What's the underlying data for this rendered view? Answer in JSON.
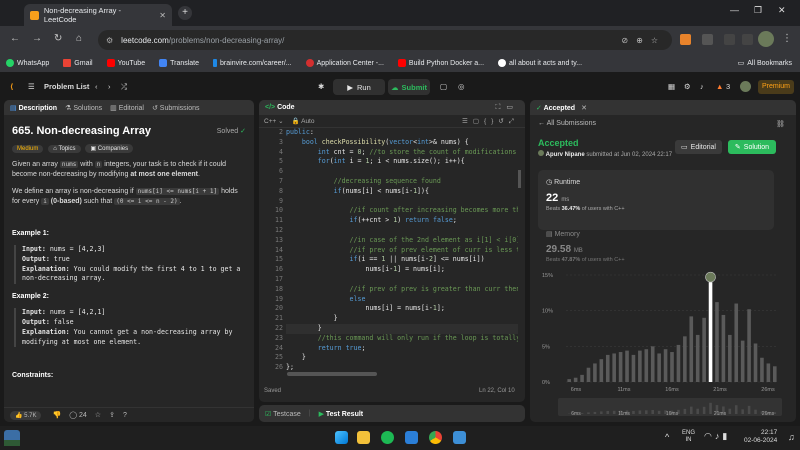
{
  "browser": {
    "tab_title": "Non-decreasing Array - LeetCode",
    "url_host": "leetcode.com",
    "url_path": "/problems/non-decreasing-array/",
    "bookmarks": [
      "WhatsApp",
      "Gmail",
      "YouTube",
      "Translate",
      "brainvire.com/career/...",
      "Application Center -...",
      "Build Python Docker a...",
      "all about it acts and ty..."
    ],
    "all_bookmarks": "All Bookmarks"
  },
  "nav": {
    "problem_list": "Problem List",
    "run": "Run",
    "submit": "Submit",
    "streak": "3",
    "premium": "Premium"
  },
  "description": {
    "tabs": [
      "Description",
      "Solutions",
      "Editorial",
      "Submissions"
    ],
    "title": "665. Non-decreasing Array",
    "solved": "Solved",
    "difficulty": "Medium",
    "topics": "Topics",
    "companies": "Companies",
    "p1a": "Given an array",
    "p1code": "nums",
    "p1b": "with",
    "p1n": "n",
    "p1c": "integers, your task is to check if it could become non-decreasing by modifying",
    "p1bold": "at most one element",
    "p2a": "We define an array is non-decreasing if",
    "p2code": "nums[i] <= nums[i + 1]",
    "p2b": "holds for every",
    "p2i": "i",
    "p2bold": "(0-based)",
    "p2c": "such that",
    "p2code2": "(0 <= i <= n - 2)",
    "ex1_title": "Example 1:",
    "ex1_input": "nums = [4,2,3]",
    "ex1_output": "true",
    "ex1_expl": "You could modify the first 4 to 1 to get a non-decreasing array.",
    "ex2_title": "Example 2:",
    "ex2_input": "nums = [4,2,1]",
    "ex2_output": "false",
    "ex2_expl": "You cannot get a non-decreasing array by modifying at most one element.",
    "constraints": "Constraints:",
    "input_label": "Input:",
    "output_label": "Output:",
    "expl_label": "Explanation:",
    "likes": "5.7K",
    "comments": "24"
  },
  "code": {
    "tab": "Code",
    "lang": "C++",
    "auto": "Auto",
    "line_numbers": [
      "2",
      "3",
      "4",
      "5",
      "6",
      "7",
      "8",
      "9",
      "10",
      "11",
      "12",
      "13",
      "14",
      "15",
      "16",
      "17",
      "18",
      "19",
      "20",
      "21",
      "22",
      "23",
      "24",
      "25",
      "26"
    ],
    "lines": [
      "public:",
      "    bool checkPossibility(vector<int>& nums) {",
      "        int cnt = 0; //to store the count of modifications",
      "        for(int i = 1; i < nums.size(); i++){",
      "",
      "            //decreasing sequence found",
      "            if(nums[i] < nums[i-1]){",
      "",
      "                //if count after increasing becomes more than 1 th",
      "                if(++cnt > 1) return false;",
      "",
      "                //in case of the 2nd element as i[1] < i[0] so mak",
      "                //if prev of prev element of curr is less than or",
      "                if(i == 1 || nums[i-2] <= nums[i])",
      "                    nums[i-1] = nums[i];",
      "",
      "                //if prev of prev is greater than curr then we hav",
      "                else",
      "                    nums[i] = nums[i-1];",
      "            }",
      "        }",
      "        //this command will only run if the loop is totally traver",
      "        return true;",
      "    }",
      "};"
    ],
    "saved": "Saved",
    "cursor": "Ln 22, Col 10"
  },
  "result_bar": {
    "testcase": "Testcase",
    "test_result": "Test Result"
  },
  "submission": {
    "tab": "Accepted",
    "back": "All Submissions",
    "status": "Accepted",
    "user": "Apurv Nipane",
    "submitted": "submitted at Jun 02, 2024 22:17",
    "editorial": "Editorial",
    "solution": "Solution",
    "runtime_label": "Runtime",
    "runtime_value": "22",
    "runtime_unit": "ms",
    "runtime_beats_a": "Beats",
    "runtime_beats_pct": "36.47%",
    "runtime_beats_b": "of users with C++",
    "memory_label": "Memory",
    "memory_value": "29.58",
    "memory_unit": "MB",
    "memory_beats_a": "Beats",
    "memory_beats_pct": "47.87%",
    "memory_beats_b": "of users with C++"
  },
  "chart_data": {
    "type": "bar",
    "y_ticks": [
      "15%",
      "10%",
      "5%",
      "0%"
    ],
    "ylim": [
      0,
      15
    ],
    "x_ticks": [
      "6ms",
      "11ms",
      "16ms",
      "21ms",
      "26ms"
    ],
    "mini_x_ticks": [
      "6ms",
      "11ms",
      "16ms",
      "21ms",
      "26ms"
    ],
    "values": [
      0.4,
      0.6,
      1.0,
      2.0,
      2.6,
      3.2,
      3.8,
      4.0,
      4.2,
      4.4,
      3.8,
      4.4,
      4.6,
      5.0,
      4.0,
      4.6,
      4.2,
      5.2,
      6.4,
      9.2,
      6.6,
      9.0,
      14.0,
      11.2,
      9.4,
      6.6,
      11.0,
      5.8,
      10.2,
      5.4,
      3.4,
      2.6,
      2.2
    ],
    "highlight_index": 22
  },
  "taskbar": {
    "lang": "ENG",
    "region": "IN",
    "time": "22:17",
    "date": "02-06-2024"
  }
}
